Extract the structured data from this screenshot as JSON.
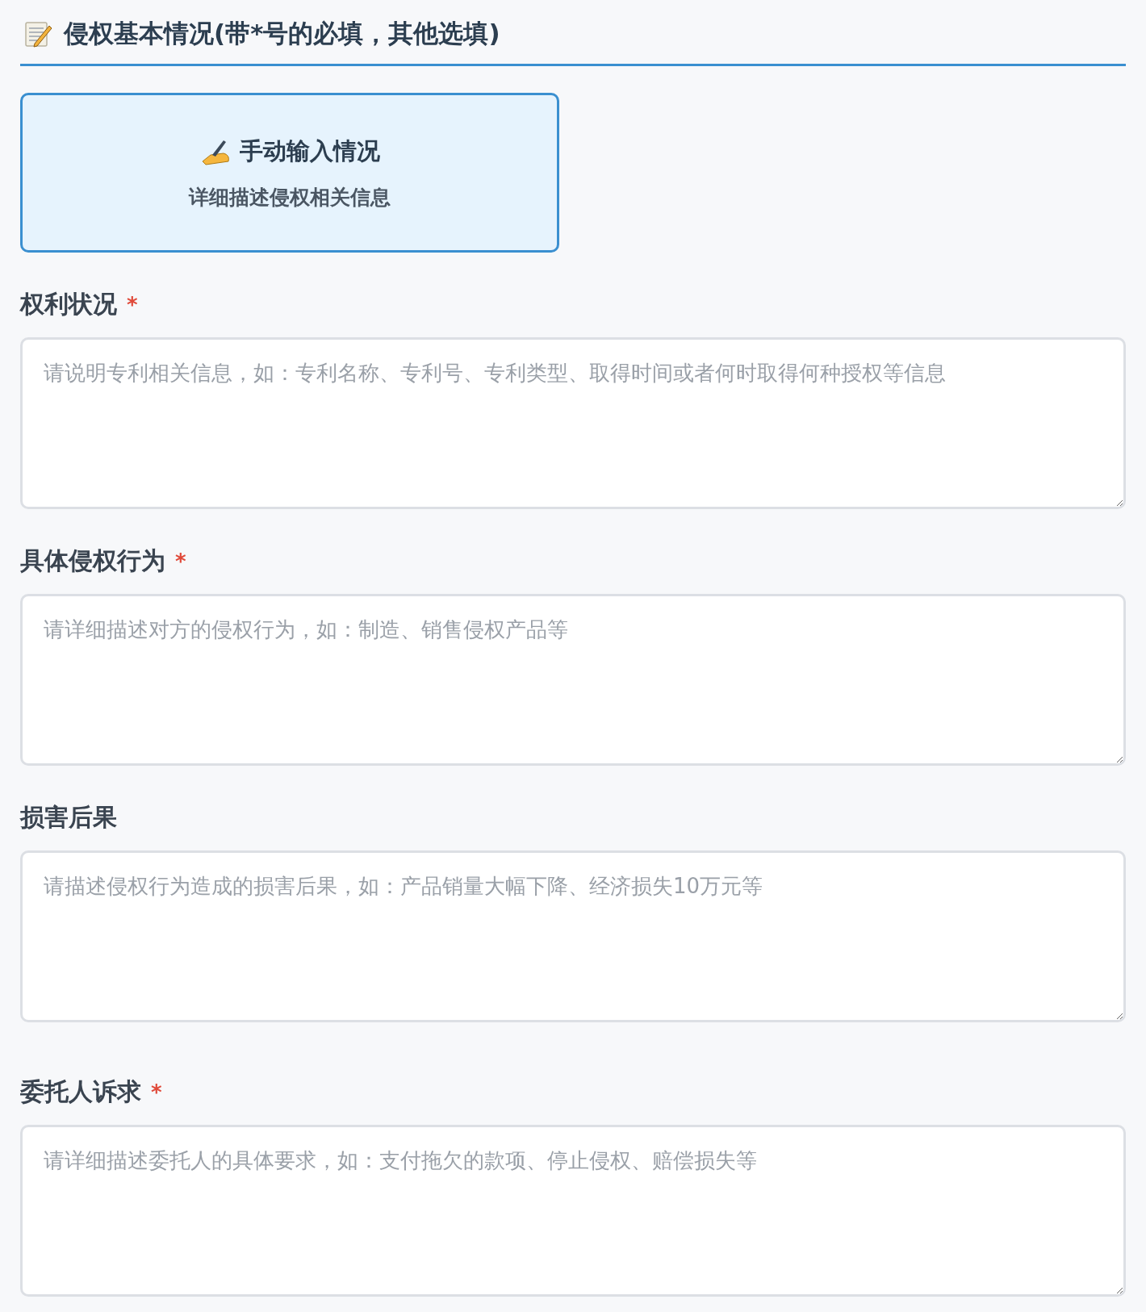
{
  "section": {
    "title": "侵权基本情况(带*号的必填，其他选填)"
  },
  "mode_card": {
    "title": "手动输入情况",
    "subtitle": "详细描述侵权相关信息",
    "selected": true
  },
  "fields": [
    {
      "label": "权利状况",
      "required_mark": "*",
      "placeholder": "请说明专利相关信息，如：专利名称、专利号、专利类型、取得时间或者何时取得何种授权等信息"
    },
    {
      "label": "具体侵权行为",
      "required_mark": "*",
      "placeholder": "请详细描述对方的侵权行为，如：制造、销售侵权产品等"
    },
    {
      "label": "损害后果",
      "placeholder": "请描述侵权行为造成的损害后果，如：产品销量大幅下降、经济损失10万元等"
    },
    {
      "label": "委托人诉求",
      "required_mark": "*",
      "placeholder": "请详细描述委托人的具体要求，如：支付拖欠的款项、停止侵权、赔偿损失等"
    }
  ]
}
